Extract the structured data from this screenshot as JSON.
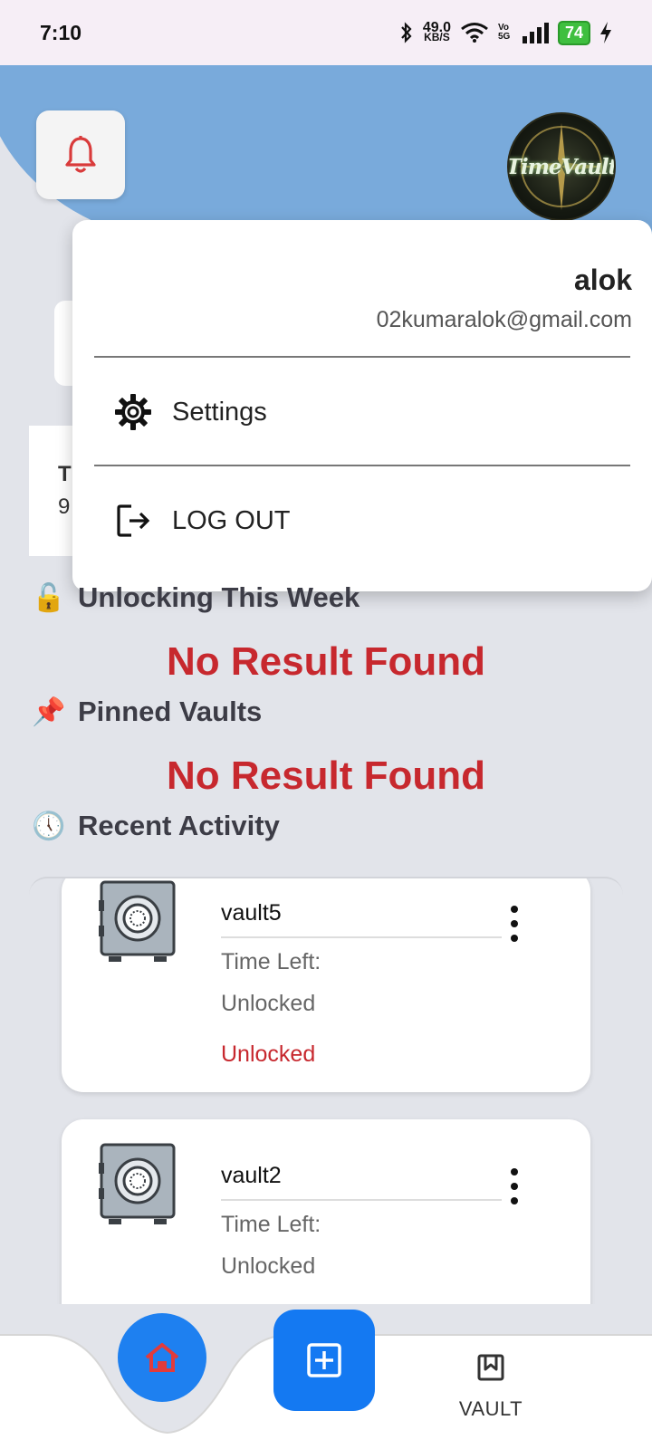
{
  "status_bar": {
    "time": "7:10",
    "network_speed_value": "49.0",
    "network_speed_unit": "KB/S",
    "volte": "Vo 5G",
    "battery": "74"
  },
  "header": {
    "bell_icon": "bell-icon",
    "avatar_text": "TimeVault"
  },
  "background_cards": {
    "partial_title": "T",
    "partial_number": "9"
  },
  "menu": {
    "user_name": "alok",
    "user_email": "02kumaralok@gmail.com",
    "settings_label": "Settings",
    "logout_label": "LOG OUT"
  },
  "sections": {
    "unlocking": {
      "emoji": "🔓",
      "title": "Unlocking This Week",
      "empty": "No Result Found"
    },
    "pinned": {
      "emoji": "📌",
      "title": "Pinned Vaults",
      "empty": "No Result Found"
    },
    "recent": {
      "emoji": "🕔",
      "title": "Recent Activity"
    }
  },
  "vaults": [
    {
      "name": "vault5",
      "time_left_label": "Time Left:",
      "time_left_value": "Unlocked",
      "status": "Unlocked"
    },
    {
      "name": "vault2",
      "time_left_label": "Time Left:",
      "time_left_value": "Unlocked",
      "status": ""
    }
  ],
  "bottom_nav": {
    "vault_label": "VAULT"
  },
  "colors": {
    "accent_blue": "#1479f2",
    "header_blue": "#79aadb",
    "alert_red": "#c7282e"
  }
}
